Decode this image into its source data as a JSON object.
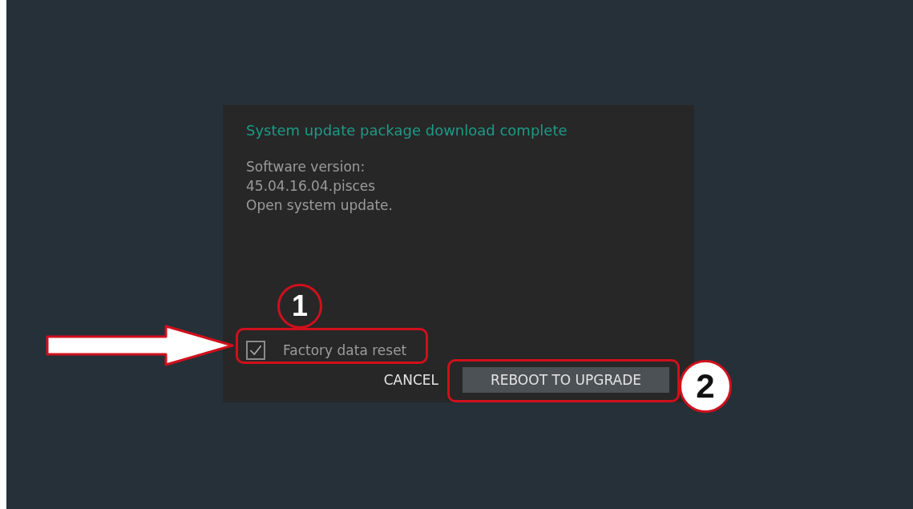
{
  "dialog": {
    "title": "System update package download complete",
    "message_lines": [
      "Software version:",
      "45.04.16.04.pisces",
      "Open system update."
    ],
    "checkbox": {
      "label": "Factory data reset",
      "checked": true
    },
    "buttons": [
      {
        "label": "CANCEL",
        "kind": "text"
      },
      {
        "label": "REBOOT TO UPGRADE",
        "kind": "filled"
      }
    ]
  },
  "annotations": [
    {
      "label": "1"
    },
    {
      "label": "2"
    }
  ]
}
